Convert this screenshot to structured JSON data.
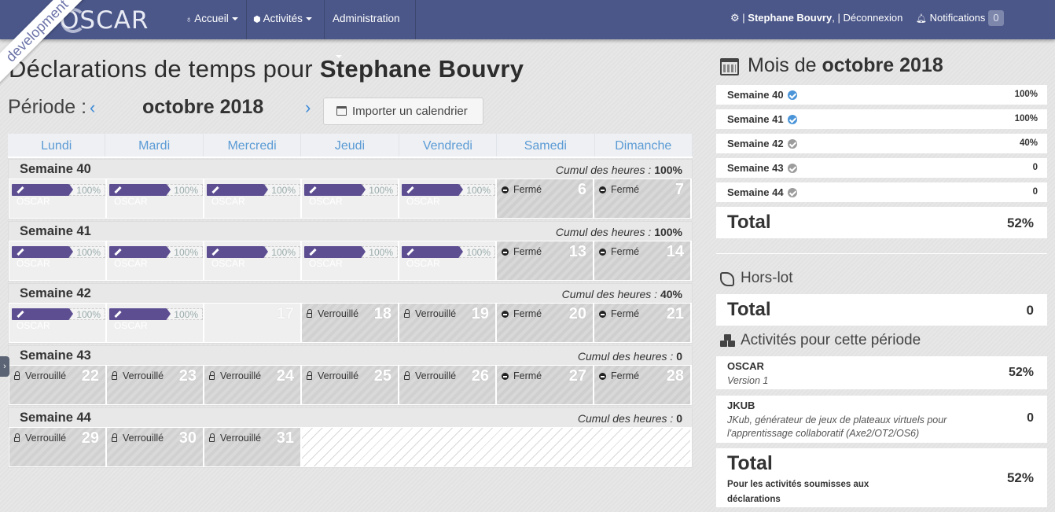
{
  "app": {
    "logo": "OSCAR",
    "env_ribbon": "development"
  },
  "nav": {
    "accueil": "Accueil",
    "activites": "Activités",
    "administration": "Administration",
    "user_separator": "|",
    "user_name": "Stephane Bouvry",
    "user_comma": ",",
    "logout": "Déconnexion",
    "notifications": "Notifications",
    "notifications_count": "0"
  },
  "page": {
    "title_prefix": "Déclarations de temps pour",
    "title_name": "Stephane Bouvry",
    "period_label": "Période :",
    "prev": "‹",
    "next": "›",
    "month": "octobre 2018",
    "import_button": "Importer un calendrier"
  },
  "days": [
    "Lundi",
    "Mardi",
    "Mercredi",
    "Jeudi",
    "Vendredi",
    "Samedi",
    "Dimanche"
  ],
  "labels": {
    "cumul": "Cumul des heures :",
    "closed": "Fermé",
    "locked": "Verrouillé"
  },
  "weeks": [
    {
      "title": "Semaine 40",
      "cumul": "100%"
    },
    {
      "title": "Semaine 41",
      "cumul": "100%"
    },
    {
      "title": "Semaine 42",
      "cumul": "40%"
    },
    {
      "title": "Semaine 43",
      "cumul": "0"
    },
    {
      "title": "Semaine 44",
      "cumul": "0"
    }
  ],
  "chip": {
    "name": "OSCAR",
    "pct": "100%"
  },
  "day_numbers": {
    "d6": "6",
    "d7": "7",
    "d13": "13",
    "d14": "14",
    "d17": "17",
    "d18": "18",
    "d19": "19",
    "d20": "20",
    "d21": "21",
    "d22": "22",
    "d23": "23",
    "d24": "24",
    "d25": "25",
    "d26": "26",
    "d27": "27",
    "d28": "28",
    "d29": "29",
    "d30": "30",
    "d31": "31"
  },
  "side": {
    "month_prefix": "Mois de",
    "month_name": "octobre 2018",
    "weeks": [
      {
        "label": "Semaine 40",
        "value": "100%",
        "validated": true
      },
      {
        "label": "Semaine 41",
        "value": "100%",
        "validated": true
      },
      {
        "label": "Semaine 42",
        "value": "40%",
        "validated": false
      },
      {
        "label": "Semaine 43",
        "value": "0",
        "validated": false
      },
      {
        "label": "Semaine 44",
        "value": "0",
        "validated": false
      }
    ],
    "total_label": "Total",
    "total_value": "52%",
    "hors_lot_title": "Hors-lot",
    "hors_lot_total_label": "Total",
    "hors_lot_total_value": "0",
    "activities_title": "Activités pour cette période",
    "activities": [
      {
        "name": "OSCAR",
        "desc": "Version 1",
        "value": "52%"
      },
      {
        "name": "JKUB",
        "desc": "JKub, générateur de jeux de plateaux virtuels pour l'apprentissage collaboratif (Axe2/OT2/OS6)",
        "value": "0"
      }
    ],
    "grand_total_label": "Total",
    "grand_total_sub": "Pour les activités soumisses aux déclarations",
    "grand_total_value": "52%"
  },
  "colors": {
    "navbar": "#4b5789",
    "chip": "#5d4e92",
    "accent_blue": "#3b8ad8",
    "validated": "#4a94d8"
  }
}
